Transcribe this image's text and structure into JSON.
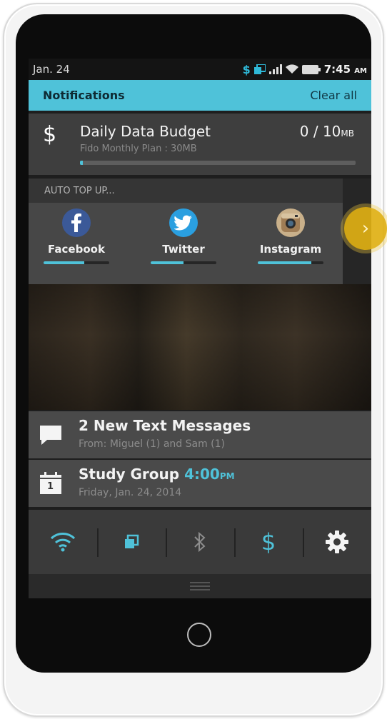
{
  "status_bar": {
    "date": "Jan. 24",
    "data_icon": "$",
    "time": "7:45",
    "ampm": "AM"
  },
  "notifications": {
    "title": "Notifications",
    "clear_all": "Clear all"
  },
  "budget": {
    "icon": "$",
    "title": "Daily Data Budget",
    "subtitle": "Fido Monthly Plan : 30MB",
    "used": "0 / 10",
    "unit": "MB",
    "progress": 0.01
  },
  "auto_top_up": {
    "label": "AUTO TOP UP...",
    "apps": [
      {
        "name": "Facebook",
        "icon": "facebook-icon",
        "progress": 0.62
      },
      {
        "name": "Twitter",
        "icon": "twitter-icon",
        "progress": 0.5
      },
      {
        "name": "Instagram",
        "icon": "instagram-icon",
        "progress": 0.82
      }
    ],
    "next_icon": "›"
  },
  "messages": {
    "title": "2 New Text Messages",
    "subtitle": "From: Miguel (1) and Sam (1)"
  },
  "study": {
    "title": "Study Group",
    "time": "4:00",
    "ampm": "PM",
    "subtitle": "Friday, Jan. 24, 2014",
    "calendar_day": "1"
  },
  "quick_settings": {
    "items": [
      "wifi-icon",
      "data-sync-icon",
      "bluetooth-icon",
      "dollar-icon",
      "settings-icon"
    ],
    "dollar": "$"
  },
  "colors": {
    "accent": "#4fc2d9",
    "highlight": "#e0b014"
  }
}
